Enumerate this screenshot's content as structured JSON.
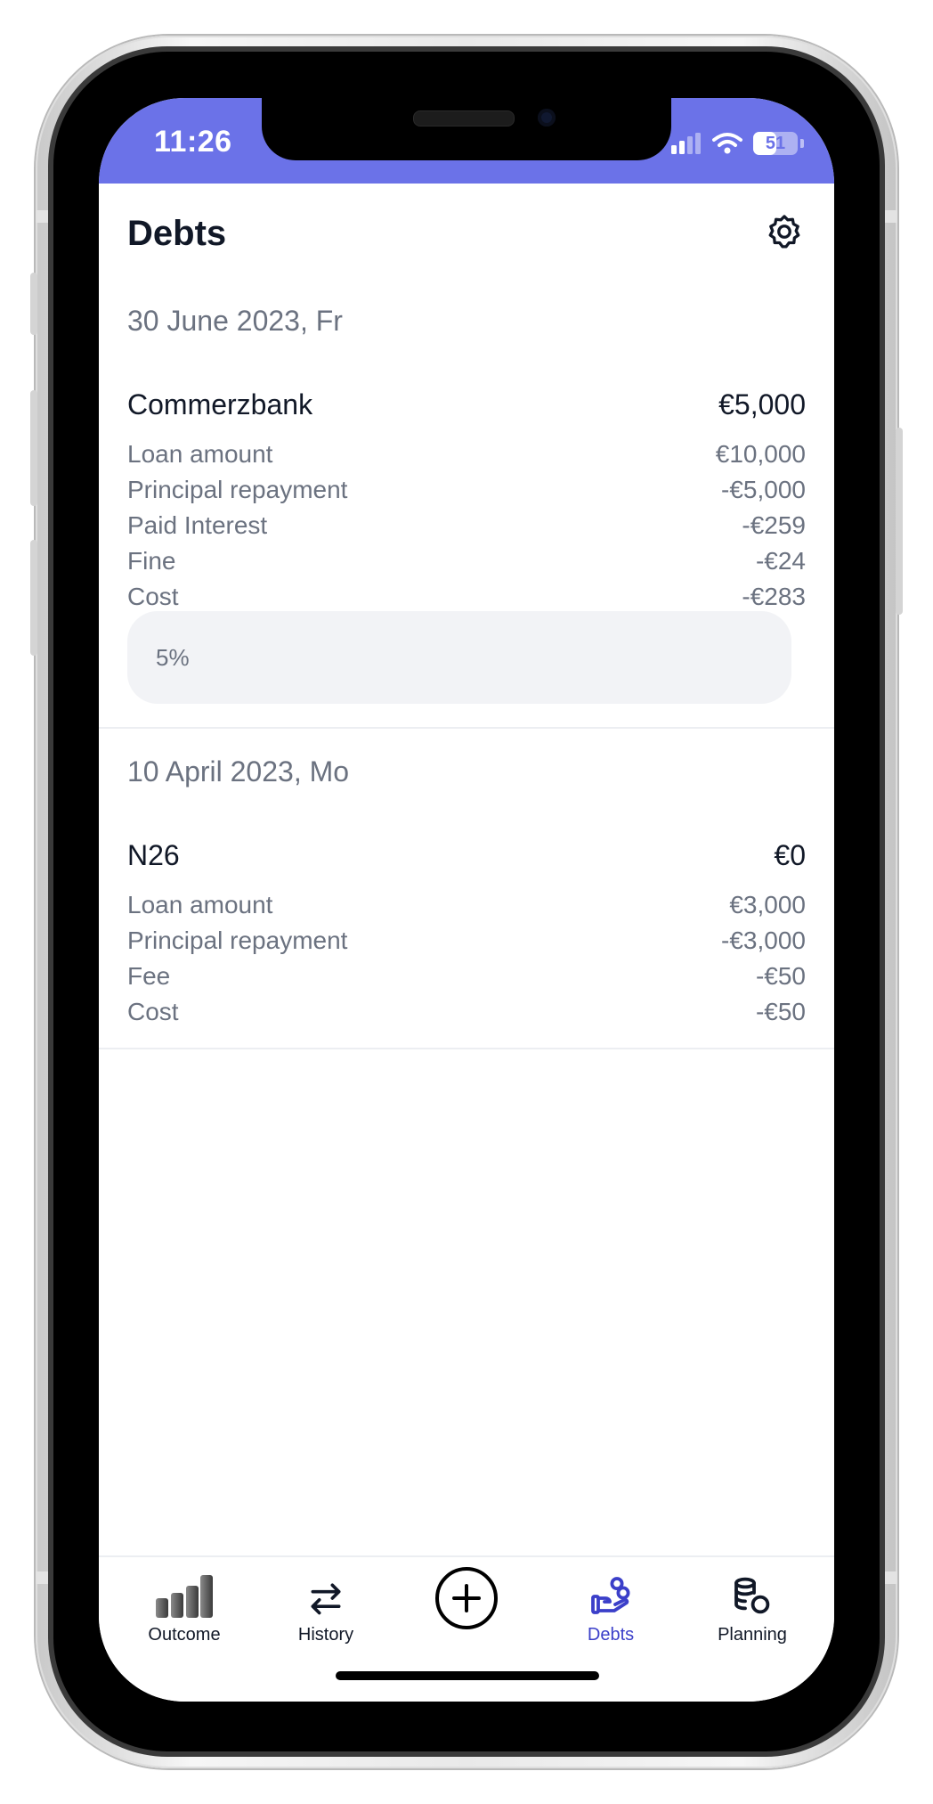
{
  "status_bar": {
    "time": "11:26",
    "battery_level": "51",
    "battery_fraction": 0.51
  },
  "header": {
    "title": "Debts",
    "settings_icon": "gear-icon"
  },
  "sections": [
    {
      "date": "30 June 2023, Fr",
      "lender": "Commerzbank",
      "balance": "€5,000",
      "rows": [
        {
          "label": "Loan amount",
          "value": "€10,000"
        },
        {
          "label": "Principal repayment",
          "value": "-€5,000"
        },
        {
          "label": "Paid Interest",
          "value": "-€259"
        },
        {
          "label": "Fine",
          "value": "-€24"
        },
        {
          "label": "Cost",
          "value": "-€283"
        }
      ],
      "note": "5%"
    },
    {
      "date": "10 April 2023, Mo",
      "lender": "N26",
      "balance": "€0",
      "rows": [
        {
          "label": "Loan amount",
          "value": "€3,000"
        },
        {
          "label": "Principal repayment",
          "value": "-€3,000"
        },
        {
          "label": "Fee",
          "value": "-€50"
        },
        {
          "label": "Cost",
          "value": "-€50"
        }
      ]
    }
  ],
  "tab_bar": {
    "tabs": [
      {
        "label": "Outcome",
        "icon": "bar-chart-icon",
        "active": false
      },
      {
        "label": "History",
        "icon": "swap-arrows-icon",
        "active": false
      },
      {
        "label": "Debts",
        "icon": "hand-coins-icon",
        "active": true
      },
      {
        "label": "Planning",
        "icon": "coins-stack-icon",
        "active": false
      }
    ],
    "add_icon": "plus-circle-icon"
  },
  "colors": {
    "accent": "#6b72e8",
    "active_tab": "#3b3fc9",
    "text_primary": "#111827",
    "text_secondary": "#6b7280"
  }
}
